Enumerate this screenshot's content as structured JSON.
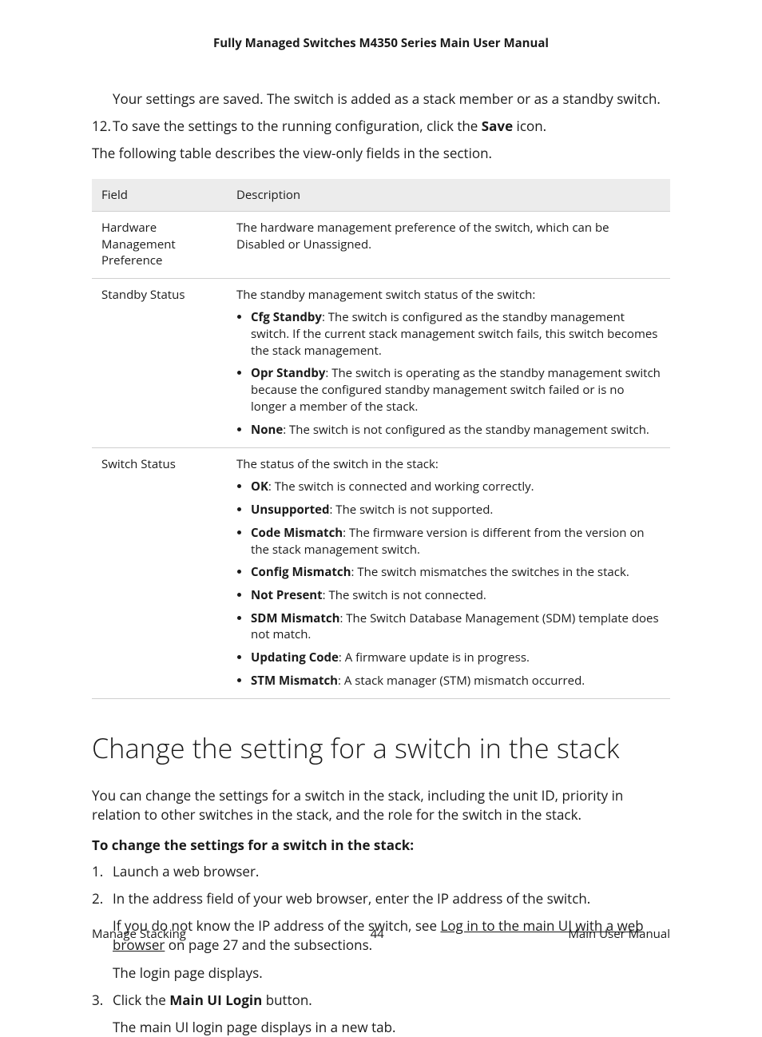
{
  "header": {
    "doc_title": "Fully Managed Switches M4350 Series Main User Manual"
  },
  "intro": {
    "saved_line": "Your settings are saved. The switch is added as a stack member or as a standby switch.",
    "step12_num": "12.",
    "step12_before": "To save the settings to the running configuration, click the ",
    "step12_bold": "Save",
    "step12_after": " icon.",
    "table_intro": "The following table describes the view-only fields in the section."
  },
  "table": {
    "hdr_field": "Field",
    "hdr_desc": "Description",
    "rows": [
      {
        "field": "Hardware Management Preference",
        "desc_lead": "The hardware management preference of the switch, which can be Disabled or Unassigned.",
        "items": []
      },
      {
        "field": "Standby Status",
        "desc_lead": "The standby management switch status of the switch:",
        "items": [
          {
            "b": "Cfg Standby",
            "t": ": The switch is configured as the standby management switch. If the current stack management switch fails, this switch becomes the stack management."
          },
          {
            "b": "Opr Standby",
            "t": ": The switch is operating as the standby management switch because the configured standby management switch failed or is no longer a member of the stack."
          },
          {
            "b": "None",
            "t": ": The switch is not configured as the standby management switch."
          }
        ]
      },
      {
        "field": "Switch Status",
        "desc_lead": "The status of the switch in the stack:",
        "items": [
          {
            "b": "OK",
            "t": ": The switch is connected and working correctly."
          },
          {
            "b": "Unsupported",
            "t": ": The switch is not supported."
          },
          {
            "b": "Code Mismatch",
            "t": ": The firmware version is different from the version on the stack management switch."
          },
          {
            "b": "Config Mismatch",
            "t": ": The switch mismatches the switches in the stack."
          },
          {
            "b": "Not Present",
            "t": ": The switch is not connected."
          },
          {
            "b": "SDM Mismatch",
            "t": ": The Switch Database Management (SDM) template does not match."
          },
          {
            "b": "Updating Code",
            "t": ": A firmware update is in progress."
          },
          {
            "b": "STM Mismatch",
            "t": ": A stack manager (STM) mismatch occurred."
          }
        ]
      }
    ]
  },
  "section": {
    "heading": "Change the setting for a switch in the stack",
    "intro": "You can change the settings for a switch in the stack, including the unit ID, priority in relation to other switches in the stack, and the role for the switch in the stack.",
    "proc_heading": "To change the settings for a switch in the stack:",
    "steps": {
      "n1": "1.",
      "s1": "Launch a web browser.",
      "n2": "2.",
      "s2": "In the address field of your web browser, enter the IP address of the switch.",
      "s2b_before": "If you do not know the IP address of the switch, see ",
      "s2b_link": "Log in to the main UI with a web browser",
      "s2b_after": " on page 27 and the subsections.",
      "s2c": "The login page displays.",
      "n3": "3.",
      "s3_before": "Click the ",
      "s3_bold": "Main UI Login",
      "s3_after": " button.",
      "s3b": "The main UI login page displays in a new tab."
    }
  },
  "footer": {
    "left": "Manage Stacking",
    "center": "44",
    "right": "Main User Manual"
  }
}
